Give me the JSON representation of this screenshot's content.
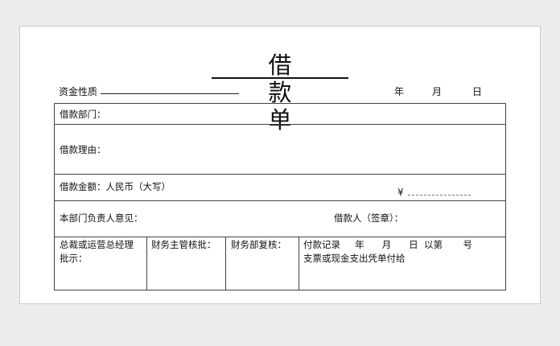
{
  "title": "借 款 单",
  "fund_nature_label": "资金性质",
  "date": {
    "year": "年",
    "month": "月",
    "day": "日"
  },
  "rows": {
    "department": "借款部门：",
    "reason": "借款理由：",
    "amount": "借款金额：人民币（大写）",
    "currency_symbol": "¥",
    "dept_head": "本部门负责人意见：",
    "borrower": "借款人（签章）："
  },
  "approvals": {
    "gm_line1": "总裁或运营总经理",
    "gm_line2": "批示：",
    "finance_supervisor": "财务主管核批：",
    "finance_review": "财务部复核：",
    "payment_record": "付款记录     年      月      日  以第       号",
    "payment_method": "支票或现金支出凭单付给"
  }
}
